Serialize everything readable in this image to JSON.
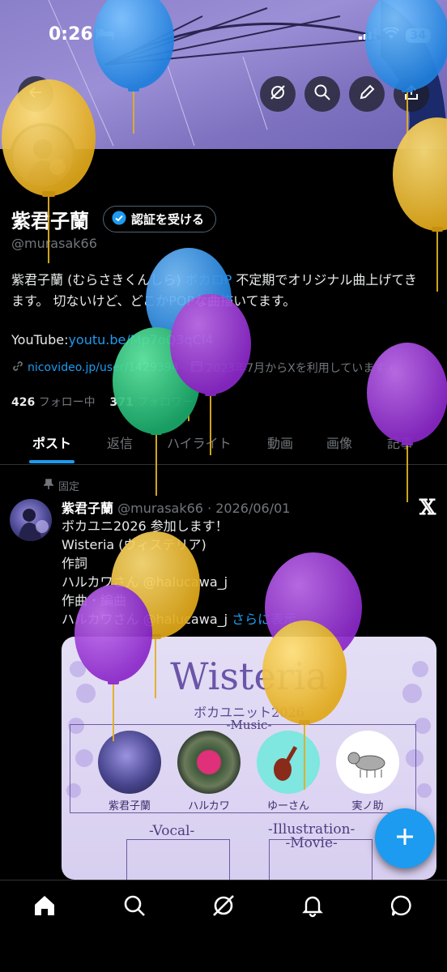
{
  "status_bar": {
    "time": "0:26",
    "battery": "34"
  },
  "profile": {
    "name": "紫君子蘭",
    "verify_label": "認証を受ける",
    "handle": "@murasak66",
    "bio_line1_pre": "紫君子蘭 (むらさきくんしら) ",
    "bio_line1_link": "ボカロP",
    "bio_line1_post": " 不定期でオリジナル曲上げてき",
    "bio_line2": "ます。 切ないけど、どこかPOPな曲描いてます。",
    "youtube_label": "YouTube:",
    "youtube_link": "youtu.be/Mp7oQ3qCl4",
    "website": "nicovideo.jp/user/1429394",
    "joined": "2023年7月からXを利用しています",
    "following_count": "426",
    "following_label": "フォロー中",
    "followers_count": "371",
    "followers_label": "フォロワー"
  },
  "tabs": [
    "ポスト",
    "返信",
    "ハイライト",
    "動画",
    "画像",
    "記事"
  ],
  "post": {
    "pinned_label": "固定",
    "author": "紫君子蘭",
    "handle_date": "@murasak66 · 2026/06/01",
    "lines": [
      "ボカユニ2026 参加します！",
      "Wisteria (ウィステリア)",
      "作詞",
      "ハルカワさん @halucawa_j",
      "作曲・編曲",
      "ハルカワさん @halucawa_j"
    ],
    "show_more": "さらに表示"
  },
  "card": {
    "title": "Wisteria",
    "subtitle": "ボカユニット2026",
    "music_label": "-Music-",
    "members": [
      "紫君子蘭",
      "ハルカワ",
      "ゆーさん",
      "実ノ助"
    ],
    "vocal_label": "-Vocal-",
    "illustration_label": "-Illustration-",
    "movie_label": "-Movie-"
  },
  "colors": {
    "accent": "#1d9bf0",
    "background": "#000000",
    "muted": "#71767b"
  }
}
